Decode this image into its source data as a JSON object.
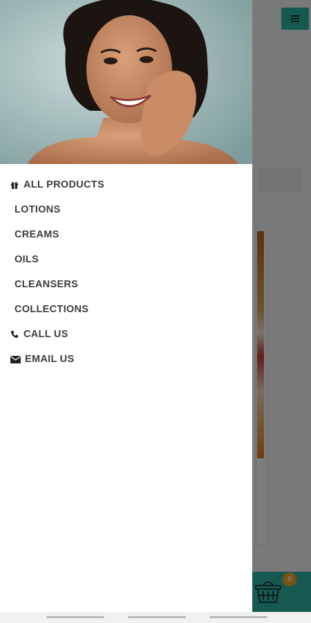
{
  "header": {
    "menu_icon": "hamburger-icon",
    "accent_color": "#2bb3a3"
  },
  "drawer": {
    "hero_image": "smiling-woman-portrait",
    "items": [
      {
        "label": "ALL PRODUCTS",
        "icon": "gift-icon"
      },
      {
        "label": "LOTIONS"
      },
      {
        "label": "CREAMS"
      },
      {
        "label": "OILS"
      },
      {
        "label": "CLEANSERS"
      },
      {
        "label": "COLLECTIONS"
      },
      {
        "label": "CALL US",
        "icon": "phone-icon"
      },
      {
        "label": "EMAIL US",
        "icon": "envelope-icon"
      }
    ]
  },
  "cart": {
    "count": "0",
    "icon": "basket-icon",
    "badge_color": "#f5a623"
  }
}
